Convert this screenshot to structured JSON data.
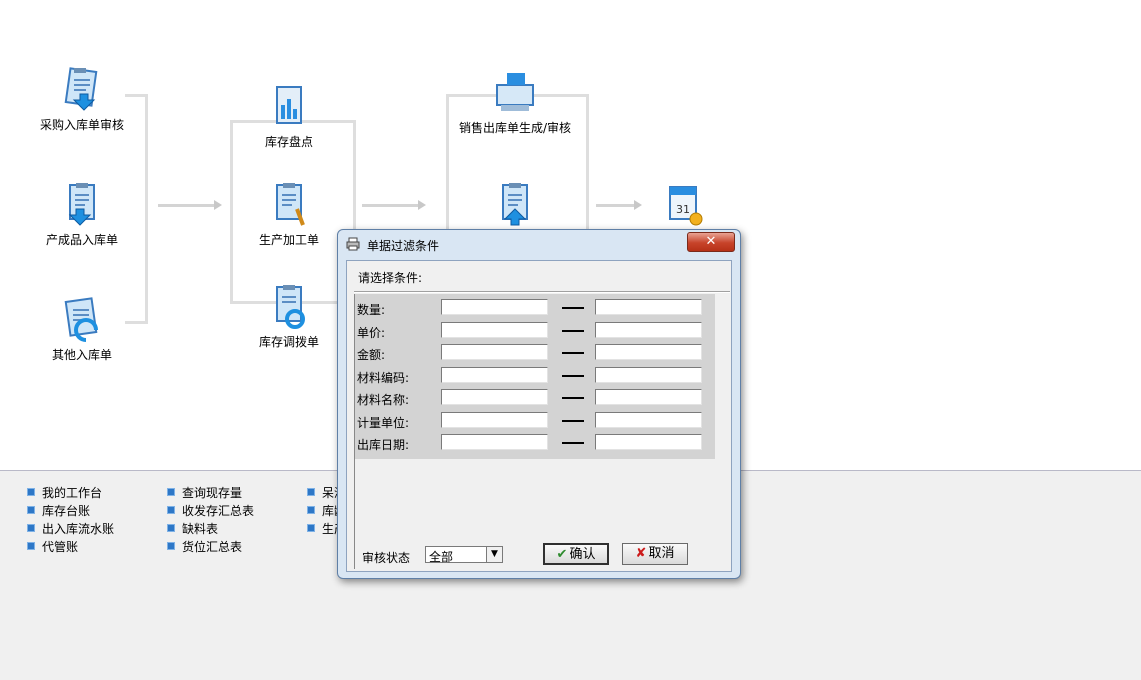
{
  "flow": {
    "nodes": [
      {
        "label": "采购入库单审核",
        "icon": "clipboard-inbound-icon"
      },
      {
        "label": "产成品入库单",
        "icon": "clipboard-product-icon"
      },
      {
        "label": "其他入库单",
        "icon": "clipboard-other-icon"
      },
      {
        "label": "库存盘点",
        "icon": "chart-clipboard-icon"
      },
      {
        "label": "生产加工单",
        "icon": "clipboard-tools-icon"
      },
      {
        "label": "库存调拨单",
        "icon": "clipboard-transfer-icon"
      },
      {
        "label": "销售出库单生成/审核",
        "icon": "computer-sales-icon"
      },
      {
        "label": "",
        "icon": "clipboard-outbound-icon"
      },
      {
        "label": "",
        "icon": "calendar-coins-icon"
      }
    ]
  },
  "links": {
    "col1": [
      "我的工作台",
      "库存台账",
      "出入库流水账",
      "代管账"
    ],
    "col2": [
      "查询现存量",
      "收发存汇总表",
      "缺料表",
      "货位汇总表"
    ],
    "col3": [
      "呆滞",
      "库龄",
      "生产"
    ]
  },
  "dialog": {
    "title": "单据过滤条件",
    "close": "✕",
    "prompt": "请选择条件:",
    "rows": [
      {
        "label": "数量:"
      },
      {
        "label": "单价:"
      },
      {
        "label": "金额:"
      },
      {
        "label": "材料编码:"
      },
      {
        "label": "材料名称:"
      },
      {
        "label": "计量单位:"
      },
      {
        "label": "出库日期:"
      }
    ],
    "status_label": "审核状态",
    "status_value": "全部",
    "ok_label": "确认",
    "cancel_label": "取消"
  }
}
